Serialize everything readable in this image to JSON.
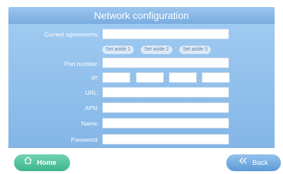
{
  "header": {
    "title": "Network configuration"
  },
  "form": {
    "current_agreements_label": "Current agreements:",
    "set_aside_1": "Set aside 1",
    "set_aside_2": "Set aside 2",
    "set_aside_3": "Set aside 3",
    "port_number_label": "Port number:",
    "ip_label": "IP:",
    "ip_dot": ".",
    "url_label": "URL:",
    "apn_label": "APN:",
    "name_label": "Name:",
    "password_label": "Password:"
  },
  "footer": {
    "home_label": "Home",
    "back_label": "Back"
  },
  "icons": {
    "home": "home-icon",
    "back": "double-chevron-left-icon"
  },
  "colors": {
    "panel": "#8fbde9",
    "home_button": "#4fc49f",
    "back_button": "#79aee3"
  }
}
